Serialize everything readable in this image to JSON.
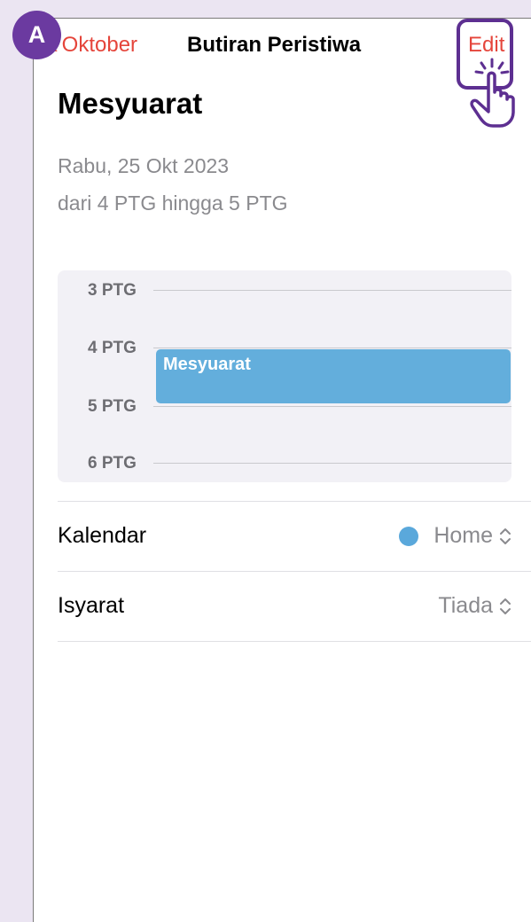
{
  "step_badge": "A",
  "nav": {
    "back_label": "Oktober",
    "title": "Butiran Peristiwa",
    "edit_label": "Edit"
  },
  "event": {
    "title": "Mesyuarat",
    "date": "Rabu, 25 Okt 2023",
    "time": "dari 4 PTG hingga 5 PTG"
  },
  "timeline": {
    "hours": [
      "3 PTG",
      "4 PTG",
      "5 PTG",
      "6 PTG"
    ],
    "event_label": "Mesyuarat"
  },
  "details": {
    "calendar_label": "Kalendar",
    "calendar_value": "Home",
    "calendar_color": "#5aa8db",
    "alert_label": "Isyarat",
    "alert_value": "Tiada"
  },
  "colors": {
    "accent": "#e5453b",
    "highlight": "#5d2f91",
    "event_block": "#63aedc"
  }
}
